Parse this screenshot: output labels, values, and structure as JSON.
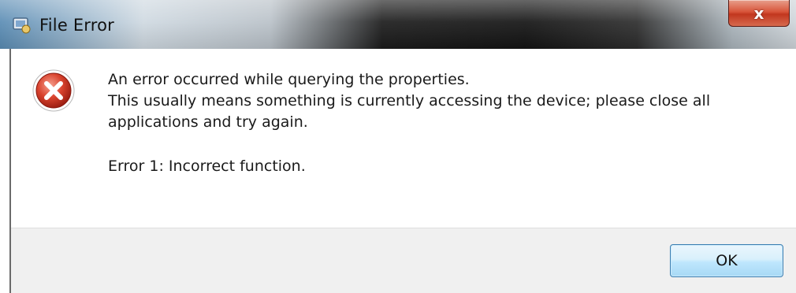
{
  "window": {
    "title": "File Error",
    "close_glyph": "x",
    "app_icon": "program-icon",
    "close_icon": "close-icon"
  },
  "message": {
    "icon": "error-icon",
    "line1": "An error occurred while querying the properties.",
    "line2": "This usually means something is currently accessing the device; please close all applications and try again.",
    "detail": "Error 1: Incorrect function."
  },
  "buttons": {
    "ok_label": "OK"
  },
  "colors": {
    "error_red": "#c0392b",
    "ok_border": "#3c7fb1",
    "close_red": "#c2371f"
  }
}
